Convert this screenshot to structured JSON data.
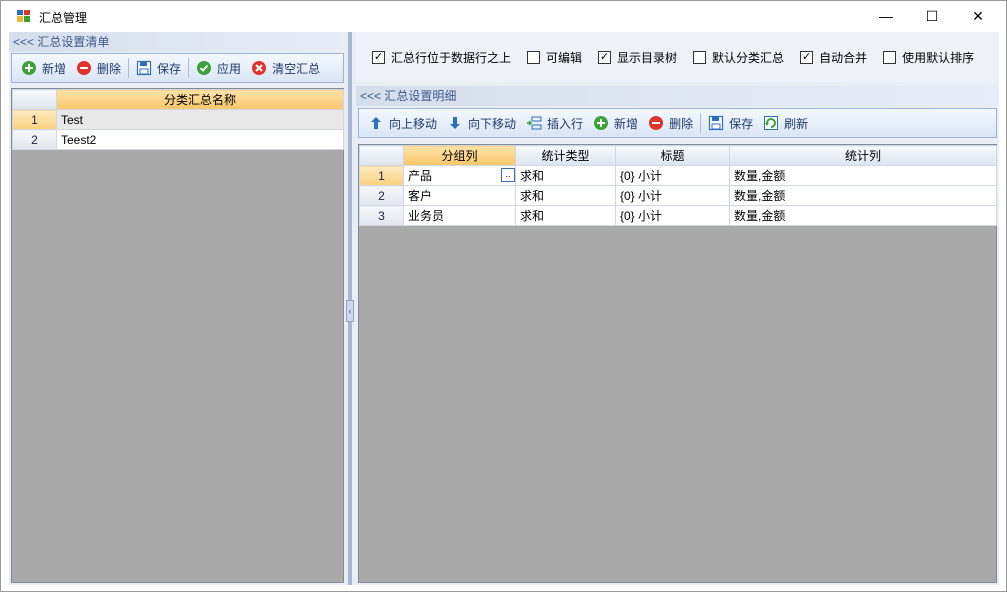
{
  "window": {
    "title": "汇总管理",
    "controls": {
      "minimize": "—",
      "maximize": "☐",
      "close": "✕"
    }
  },
  "left": {
    "header": "<<< 汇总设置清单",
    "toolbar": [
      {
        "name": "add",
        "label": "新增",
        "icon": "plus-circle-icon",
        "color": "#3aa236"
      },
      {
        "name": "delete",
        "label": "删除",
        "icon": "minus-circle-icon",
        "color": "#e0332a"
      },
      {
        "name": "save",
        "label": "保存",
        "icon": "save-icon",
        "color": "#2f6fb8"
      },
      {
        "name": "apply",
        "label": "应用",
        "icon": "check-circle-icon",
        "color": "#3aa236"
      },
      {
        "name": "clear",
        "label": "清空汇总",
        "icon": "x-circle-icon",
        "color": "#e0332a"
      }
    ],
    "grid": {
      "columns": [
        "分类汇总名称"
      ],
      "rows": [
        {
          "num": "1",
          "name": "Test"
        },
        {
          "num": "2",
          "name": "Teest2"
        }
      ]
    }
  },
  "right": {
    "options": [
      {
        "label": "汇总行位于数据行之上",
        "checked": true
      },
      {
        "label": "可编辑",
        "checked": false
      },
      {
        "label": "显示目录树",
        "checked": true
      },
      {
        "label": "默认分类汇总",
        "checked": false
      },
      {
        "label": "自动合并",
        "checked": true
      },
      {
        "label": "使用默认排序",
        "checked": false
      }
    ],
    "header": "<<< 汇总设置明细",
    "toolbar": [
      {
        "name": "move-up",
        "label": "向上移动",
        "icon": "arrow-up-icon",
        "color": "#2f6fb8"
      },
      {
        "name": "move-down",
        "label": "向下移动",
        "icon": "arrow-down-icon",
        "color": "#2f6fb8"
      },
      {
        "name": "insert-row",
        "label": "插入行",
        "icon": "insert-row-icon",
        "color": "#2f6fb8"
      },
      {
        "name": "add",
        "label": "新增",
        "icon": "plus-circle-icon",
        "color": "#3aa236"
      },
      {
        "name": "delete",
        "label": "删除",
        "icon": "minus-circle-icon",
        "color": "#e0332a"
      },
      {
        "name": "save",
        "label": "保存",
        "icon": "save-icon",
        "color": "#2f6fb8"
      },
      {
        "name": "refresh",
        "label": "刷新",
        "icon": "refresh-icon",
        "color": "#3aa236"
      }
    ],
    "grid": {
      "columns": [
        "分组列",
        "统计类型",
        "标题",
        "统计列"
      ],
      "rows": [
        {
          "num": "1",
          "group": "产品",
          "type": "求和",
          "title": "{0} 小计",
          "stat": "数量,金额"
        },
        {
          "num": "2",
          "group": "客户",
          "type": "求和",
          "title": "{0} 小计",
          "stat": "数量,金额"
        },
        {
          "num": "3",
          "group": "业务员",
          "type": "求和",
          "title": "{0} 小计",
          "stat": "数量,金额"
        }
      ],
      "ellipsis": ".."
    }
  }
}
